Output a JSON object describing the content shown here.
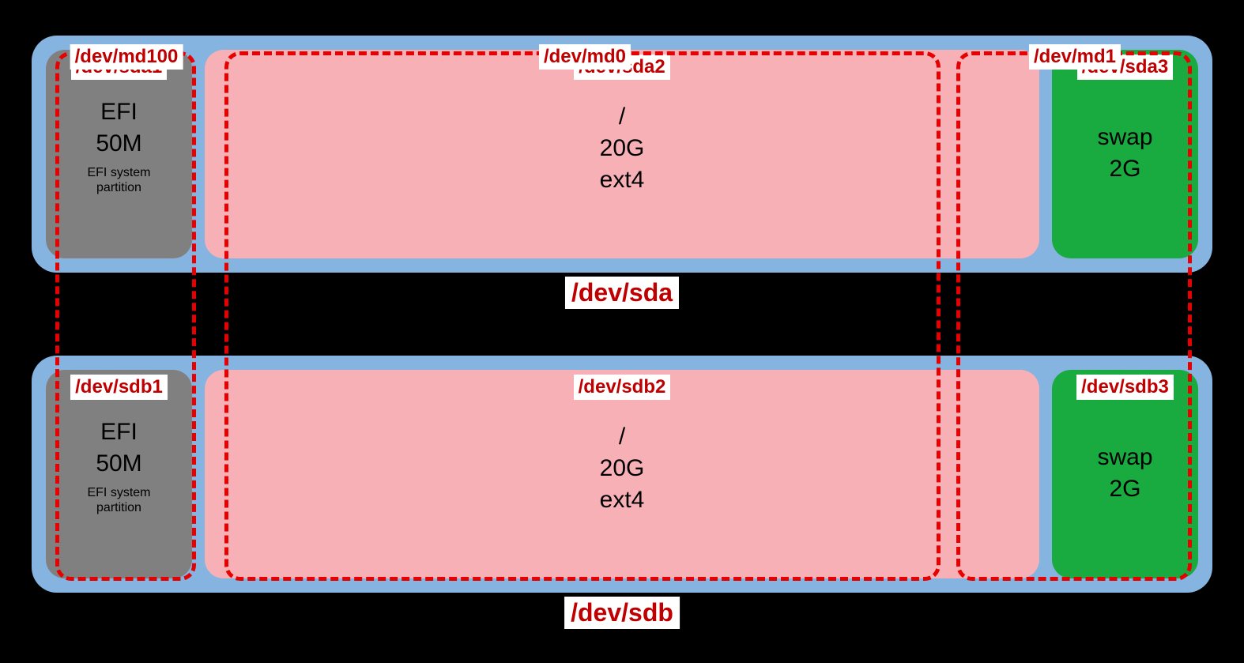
{
  "disks": {
    "sda": {
      "label": "/dev/sda",
      "partitions": {
        "p1": {
          "dev": "/dev/sda1",
          "mount": "EFI",
          "size": "50M",
          "sub1": "EFI system",
          "sub2": "partition"
        },
        "p2": {
          "dev": "/dev/sda2",
          "mount": "/",
          "size": "20G",
          "fs": "ext4"
        },
        "p3": {
          "dev": "/dev/sda3",
          "mount": "swap",
          "size": "2G"
        }
      }
    },
    "sdb": {
      "label": "/dev/sdb",
      "partitions": {
        "p1": {
          "dev": "/dev/sdb1",
          "mount": "EFI",
          "size": "50M",
          "sub1": "EFI system",
          "sub2": "partition"
        },
        "p2": {
          "dev": "/dev/sdb2",
          "mount": "/",
          "size": "20G",
          "fs": "ext4"
        },
        "p3": {
          "dev": "/dev/sdb3",
          "mount": "swap",
          "size": "2G"
        }
      }
    }
  },
  "md": {
    "md100": "/dev/md100",
    "md0": "/dev/md0",
    "md1": "/dev/md1"
  }
}
